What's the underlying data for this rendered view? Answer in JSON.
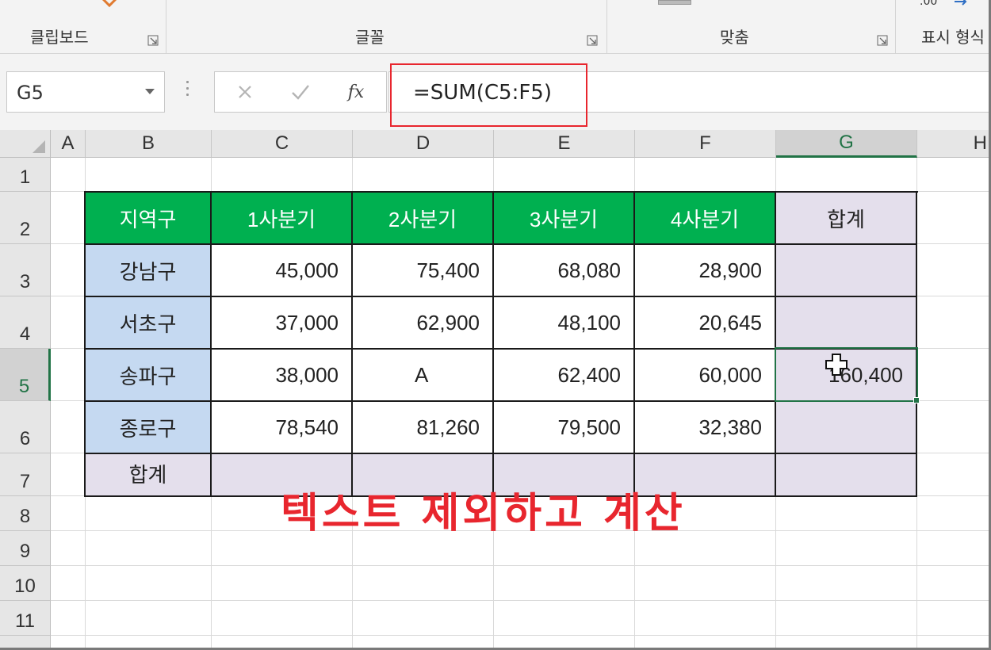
{
  "ribbon": {
    "groups": [
      {
        "label": "클립보드"
      },
      {
        "label": "글꼴"
      },
      {
        "label": "맞춤"
      },
      {
        "label": "표시 형식"
      }
    ],
    "number_format_snippet": ".00"
  },
  "formula_bar": {
    "name_box": "G5",
    "fx_label": "fx",
    "formula": "=SUM(C5:F5)"
  },
  "columns": [
    "A",
    "B",
    "C",
    "D",
    "E",
    "F",
    "G",
    "H"
  ],
  "selected_column": "G",
  "rows": [
    "1",
    "2",
    "3",
    "4",
    "5",
    "6",
    "7",
    "8",
    "9",
    "10",
    "11"
  ],
  "selected_row": "5",
  "table": {
    "headers": [
      "지역구",
      "1사분기",
      "2사분기",
      "3사분기",
      "4사분기",
      "합계"
    ],
    "rows": [
      {
        "region": "강남구",
        "values": [
          "45,000",
          "75,400",
          "68,080",
          "28,900",
          ""
        ]
      },
      {
        "region": "서초구",
        "values": [
          "37,000",
          "62,900",
          "48,100",
          "20,645",
          ""
        ]
      },
      {
        "region": "송파구",
        "values": [
          "38,000",
          "A",
          "62,400",
          "60,000",
          "160,400"
        ]
      },
      {
        "region": "종로구",
        "values": [
          "78,540",
          "81,260",
          "79,500",
          "32,380",
          ""
        ]
      }
    ],
    "total_label": "합계"
  },
  "annotation": "텍스트 제외하고 계산",
  "colors": {
    "header_green": "#00b050",
    "region_blue": "#c5d9f1",
    "total_lavender": "#e4dfec",
    "excel_green": "#217346",
    "annotation_red": "#e8262e"
  }
}
